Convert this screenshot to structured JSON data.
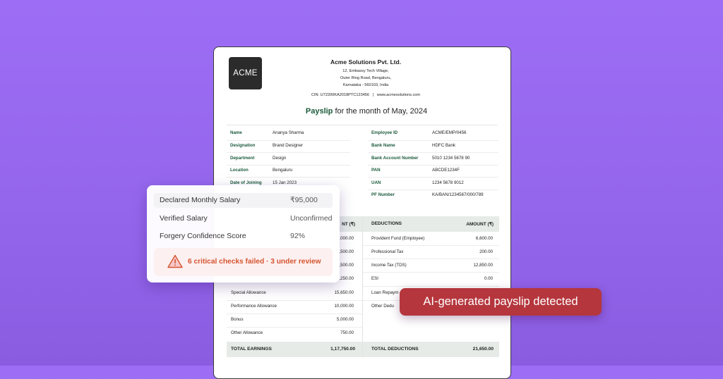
{
  "payslip": {
    "logo": "ACME",
    "company": "Acme Solutions Pvt. Ltd.",
    "address_lines": [
      "12, Embassy Tech Village,",
      "Outer Ring Road, Bengaluru,",
      "Karnataka - 560103, India"
    ],
    "cin_line": "CIN: U72200KA2018PTC123456   |   www.acmesolutions.com",
    "title_highlight": "Payslip",
    "title_rest": " for the month of May, 2024",
    "left_info": [
      {
        "label": "Name",
        "value": "Ananya Sharma"
      },
      {
        "label": "Designation",
        "value": "Brand Designer"
      },
      {
        "label": "Department",
        "value": "Design"
      },
      {
        "label": "Location",
        "value": "Bengaluru"
      },
      {
        "label": "Date of Joining",
        "value": "15 Jan 2023"
      }
    ],
    "right_info": [
      {
        "label": "Employee ID",
        "value": "ACME/EMP/0456"
      },
      {
        "label": "Bank Name",
        "value": "HDFC Bank"
      },
      {
        "label": "Bank Account Number",
        "value": "5010 1234 5678 90"
      },
      {
        "label": "PAN",
        "value": "ABCDE1234F"
      },
      {
        "label": "UAN",
        "value": "1234 5678 9012"
      },
      {
        "label": "PF Number",
        "value": "KA/BAN/1234567/000/789"
      }
    ],
    "earnings_amount_header": "NT (₹)",
    "deductions_header": "DEDUCTIONS",
    "deductions_amount_header": "AMOUNT (₹)",
    "earnings_partial_amounts": [
      ".000.00",
      ",500.00",
      ",500.00",
      ",250.00"
    ],
    "earnings_rows": [
      {
        "label": "Special Allowance",
        "amount": "15,650.00"
      },
      {
        "label": "Performance Allowance",
        "amount": "10,000.00"
      },
      {
        "label": "Bonus",
        "amount": "5,000.00"
      },
      {
        "label": "Other Allowance",
        "amount": "750.00"
      }
    ],
    "deductions_rows": [
      {
        "label": "Provident Fund (Employee)",
        "amount": "6,600.00"
      },
      {
        "label": "Professional Tax",
        "amount": "200.00"
      },
      {
        "label": "Income Tax (TDS)",
        "amount": "12,850.00"
      },
      {
        "label": "ESI",
        "amount": "0.00"
      },
      {
        "label": "Loan Repaym",
        "amount": ""
      },
      {
        "label": "Other Dedu",
        "amount": ""
      }
    ],
    "total_earnings_label": "TOTAL EARNINGS",
    "total_earnings": "1,17,750.00",
    "total_deductions_label": "TOTAL DEDUCTIONS",
    "total_deductions": "21,650.00"
  },
  "verification_card": {
    "rows": [
      {
        "label": "Declared Monthly Salary",
        "value": "₹95,000"
      },
      {
        "label": "Verified Salary",
        "value": "Unconfirmed"
      },
      {
        "label": "Forgery Confidence Score",
        "value": "92%"
      }
    ],
    "alert_icon": "warning-icon",
    "alert_text": "6 critical checks failed · 3 under review"
  },
  "ai_badge": "AI-generated payslip detected",
  "colors": {
    "background": "#9466ec",
    "payslip_accent": "#1a5a3a",
    "alert_text": "#d5542f",
    "alert_bg": "#fdf0f0",
    "badge_bg": "#b5363d"
  }
}
